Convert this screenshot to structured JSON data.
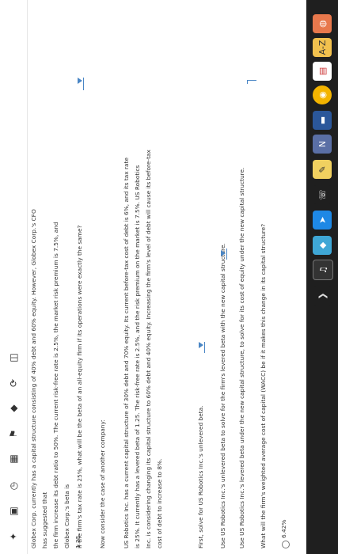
{
  "toolbar_left": {
    "icons": [
      "pin-icon",
      "tablet-icon",
      "clock-icon",
      "calendar-icon",
      "flag-icon",
      "square-icon",
      "refresh-icon",
      "reader-icon"
    ]
  },
  "taskbar": {
    "icons": [
      "wifi-app-icon",
      "az-dictionary-icon",
      "schedule-app-icon",
      "chrome-icon",
      "folder-icon",
      "notes-icon",
      "photo-icon",
      "whatsapp-icon",
      "telegram-icon",
      "kite-icon",
      "media-app-icon",
      "next-arrow-icon"
    ],
    "labels": {
      "az": "A-Z",
      "notes": "N"
    }
  },
  "content": {
    "intro": [
      "Globex Corp. currently has a capital structure consisting of 40% debt and 60% equity. However, Globex Corp.'s CFO has suggested that",
      "the firm increase its debt ratio to 50%. The current risk-free rate is 2.5%, the market risk premium is 7.5%, and Globex Corp.'s beta is",
      "1.25."
    ],
    "q_unlevered": "If the firm's tax rate is 25%, what will be the beta of an all-equity firm if its operations were exactly the same?",
    "consider": "Now consider the case of another company:",
    "usr": [
      "US Robotics Inc. has a current capital structure of 30% debt and 70% equity. Its current before-tax cost of debt is 6%, and its tax rate",
      "is 25%. It currently has a levered beta of 1.25. The risk-free rate is 2.5%, and the risk premium on the market is 7.5%. US Robotics",
      "Inc. is considering changing its capital structure to 60% debt and 40% equity. Increasing the firm's level of debt will cause its before-tax",
      "cost of debt to increase to 8%."
    ],
    "first": "First, solve for US Robotics Inc.'s unlevered beta.",
    "levered": "Use US Robotics Inc.'s unlevered beta to solve for the firm's levered beta with the new capital structure.",
    "cost_equity": "Use US Robotics Inc.'s levered beta under the new capital structure, to solve for its cost of equity under the new capital structure.",
    "wacc_q": "What will the firm's weighted average cost of capital (WACC) be if it makes this change in its capital structure?",
    "option1": "6.42%"
  },
  "colors": {
    "accent": "#4a86c5",
    "rule": "#e0d9a8",
    "taskbar": "#1f1f1f",
    "text": "#333333"
  }
}
